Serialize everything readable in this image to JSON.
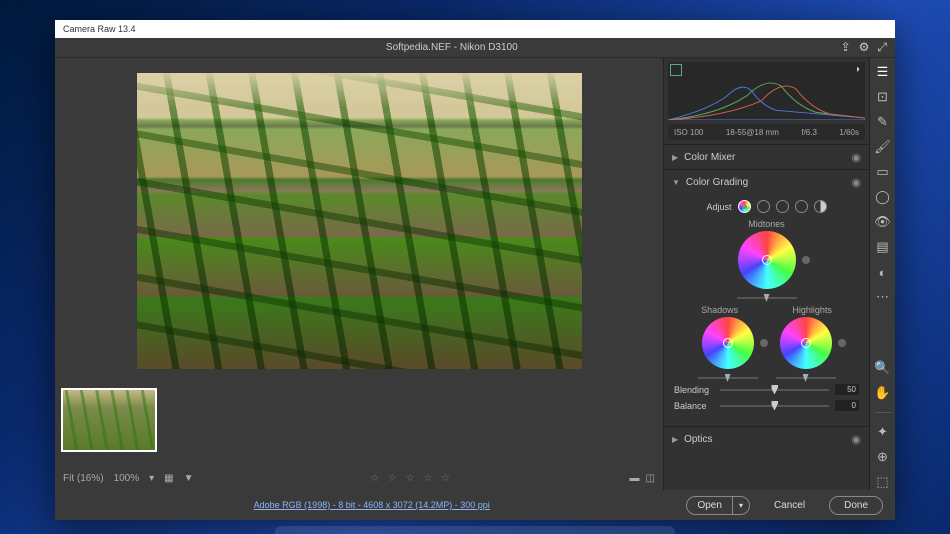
{
  "app": {
    "title": "Camera Raw 13.4"
  },
  "header": {
    "filename": "Softpedia.NEF",
    "camera": "Nikon D3100"
  },
  "histogram": {
    "iso": "ISO  100",
    "lens": "18-55@18 mm",
    "aperture": "f/6.3",
    "shutter": "1/60s"
  },
  "panels": {
    "colorMixer": {
      "title": "Color Mixer"
    },
    "colorGrading": {
      "title": "Color Grading",
      "adjust": "Adjust",
      "midtones": "Midtones",
      "shadows": "Shadows",
      "highlights": "Highlights",
      "blending": {
        "label": "Blending",
        "value": "50",
        "pos": 50
      },
      "balance": {
        "label": "Balance",
        "value": "0",
        "pos": 50
      }
    },
    "optics": {
      "title": "Optics"
    }
  },
  "bottombar": {
    "fit": "Fit (16%)",
    "hundred": "100%"
  },
  "footer": {
    "info": "Adobe RGB (1998) - 8 bit - 4608 x 3072 (14.2MP) - 300 ppi",
    "open": "Open",
    "cancel": "Cancel",
    "done": "Done"
  }
}
